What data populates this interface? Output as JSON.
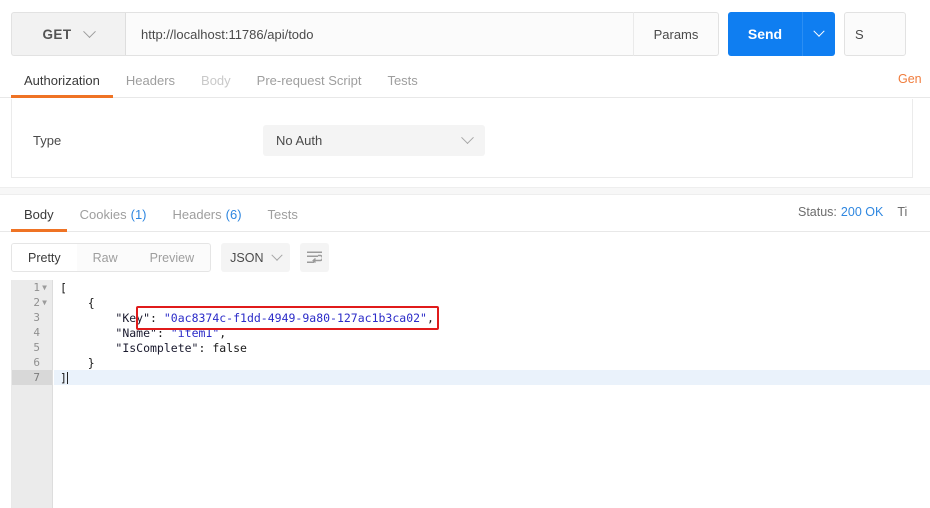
{
  "request": {
    "method": "GET",
    "url": "http://localhost:11786/api/todo",
    "params_label": "Params",
    "send_label": "Send",
    "save_label": "S",
    "generate_code_label": "Gen",
    "tabs": [
      {
        "label": "Authorization",
        "active": true
      },
      {
        "label": "Headers",
        "active": false
      },
      {
        "label": "Body",
        "active": false,
        "dim": true
      },
      {
        "label": "Pre-request Script",
        "active": false
      },
      {
        "label": "Tests",
        "active": false
      }
    ]
  },
  "authorization": {
    "type_label": "Type",
    "type_value": "No Auth"
  },
  "response": {
    "tabs": [
      {
        "label": "Body",
        "count": "",
        "active": true
      },
      {
        "label": "Cookies",
        "count": "(1)",
        "active": false
      },
      {
        "label": "Headers",
        "count": "(6)",
        "active": false
      },
      {
        "label": "Tests",
        "count": "",
        "active": false
      }
    ],
    "status_label": "Status:",
    "status_value": "200 OK",
    "time_label": "Ti",
    "view_modes": [
      {
        "label": "Pretty",
        "active": true
      },
      {
        "label": "Raw",
        "active": false
      },
      {
        "label": "Preview",
        "active": false
      }
    ],
    "format": "JSON",
    "body_lines": [
      {
        "num": "1",
        "fold": true,
        "active": false,
        "tokens": [
          {
            "t": "[",
            "c": "plain"
          }
        ]
      },
      {
        "num": "2",
        "fold": true,
        "active": false,
        "tokens": [
          {
            "t": "    {",
            "c": "plain"
          }
        ]
      },
      {
        "num": "3",
        "fold": false,
        "active": false,
        "tokens": [
          {
            "t": "        ",
            "c": "plain"
          },
          {
            "t": "\"Key\"",
            "c": "key"
          },
          {
            "t": ": ",
            "c": "plain"
          },
          {
            "t": "\"0ac8374c-f1dd-4949-9a80-127ac1b3ca02\"",
            "c": "str"
          },
          {
            "t": ",",
            "c": "plain"
          }
        ]
      },
      {
        "num": "4",
        "fold": false,
        "active": false,
        "tokens": [
          {
            "t": "        ",
            "c": "plain"
          },
          {
            "t": "\"Name\"",
            "c": "key"
          },
          {
            "t": ": ",
            "c": "plain"
          },
          {
            "t": "\"item1\"",
            "c": "str"
          },
          {
            "t": ",",
            "c": "plain"
          }
        ]
      },
      {
        "num": "5",
        "fold": false,
        "active": false,
        "tokens": [
          {
            "t": "        ",
            "c": "plain"
          },
          {
            "t": "\"IsComplete\"",
            "c": "key"
          },
          {
            "t": ": ",
            "c": "plain"
          },
          {
            "t": "false",
            "c": "bool"
          }
        ]
      },
      {
        "num": "6",
        "fold": false,
        "active": false,
        "tokens": [
          {
            "t": "    }",
            "c": "plain"
          }
        ]
      },
      {
        "num": "7",
        "fold": false,
        "active": true,
        "tokens": [
          {
            "t": "]",
            "c": "plain"
          }
        ],
        "caret": true
      }
    ]
  },
  "colors": {
    "accent_orange": "#ef7324",
    "send_blue": "#0f7ef1",
    "status_blue": "#2f87e0",
    "json_string": "#2b2bc8",
    "highlight_red": "#e01b1b"
  }
}
